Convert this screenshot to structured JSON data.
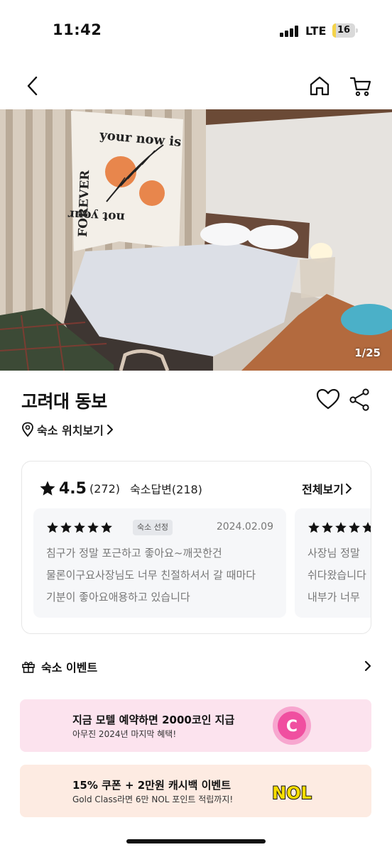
{
  "status_bar": {
    "time": "11:42",
    "network": "LTE",
    "battery": "16",
    "battery_level": 0.16,
    "battery_color": "#f4d34a"
  },
  "nav": {
    "back_icon": "chevron-left-icon",
    "home_icon": "home-icon",
    "cart_icon": "cart-icon"
  },
  "gallery": {
    "counter": "1/25",
    "photo_texts": [
      "your now is",
      "not your",
      "FOREVER"
    ]
  },
  "property": {
    "name": "고려대 동보",
    "location_link": "숙소 위치보기",
    "favorite_icon": "heart-outline-icon",
    "share_icon": "share-icon"
  },
  "reviews": {
    "rating": "4.5",
    "count": "(272)",
    "host_replies": "숙소답변(218)",
    "see_all": "전체보기",
    "items": [
      {
        "stars": 5,
        "badge": "숙소 선정",
        "date": "2024.02.09",
        "text": "침구가 정말 포근하고 좋아요~깨끗한건 물론이구요사장님도 너무 친절하셔서 갈 때마다 기분이 좋아요애용하고 있습니다"
      },
      {
        "stars": 5,
        "badge": "",
        "date": "",
        "text": "사장님 정말\n쉬다왔습니다\n내부가 너무"
      }
    ]
  },
  "events": {
    "header": "숙소 이벤트",
    "promos": [
      {
        "title": "지금 모텔 예약하면 2000코인 지급",
        "subtitle": "아무진 2024년 마지막 혜택!",
        "logo": "C",
        "bg": "#fce3ee"
      },
      {
        "title": "15% 쿠폰 + 2만원 캐시백 이벤트",
        "subtitle": "Gold Class라면 6만 NOL 포인트 적립까지!",
        "logo": "NOL",
        "bg": "#fdebe2"
      }
    ]
  },
  "colors": {
    "star": "#111111",
    "text_muted": "#777777",
    "review_bg": "#f6f7f9",
    "coin_pink": "#f04fa0",
    "nol_yellow": "#f7dc00"
  }
}
